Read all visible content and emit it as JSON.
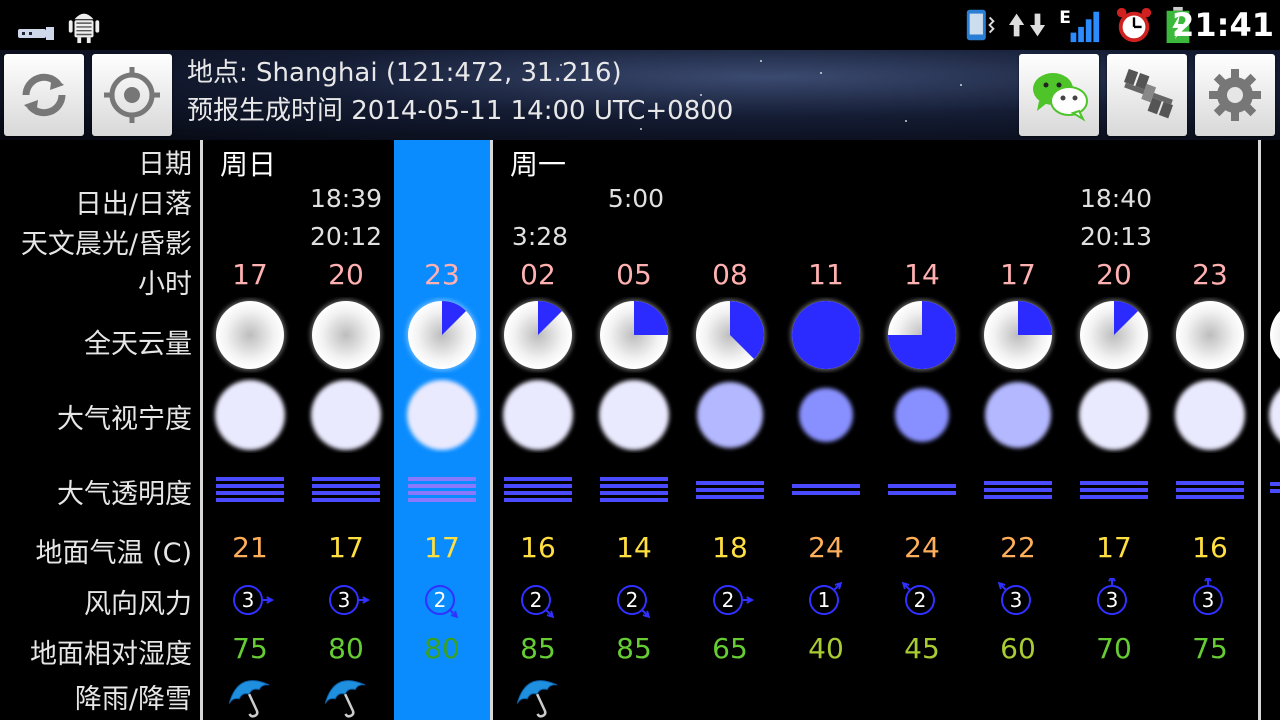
{
  "status_bar": {
    "time": "21:41",
    "icons": [
      "usb-icon",
      "android-debug-icon",
      "vibrate-icon",
      "data-updown-icon",
      "signal-e-icon",
      "alarm-icon",
      "battery-charging-icon"
    ]
  },
  "header": {
    "location_line": "地点: Shanghai (121:472, 31.216)",
    "generated_line": "预报生成时间 2014-05-11 14:00 UTC+0800",
    "buttons": [
      "refresh-button",
      "locate-button",
      "wechat-share-button",
      "satellite-button",
      "settings-button"
    ]
  },
  "row_labels": {
    "date": "日期",
    "sunrise_sunset": "日出/日落",
    "twilight": "天文晨光/昏影",
    "hour": "小时",
    "cloud": "全天云量",
    "seeing": "大气视宁度",
    "transparency": "大气透明度",
    "temperature": "地面气温 (C)",
    "wind": "风向风力",
    "humidity": "地面相对湿度",
    "precipitation": "降雨/降雪"
  },
  "days": [
    {
      "name": "周日"
    },
    {
      "name": "周一"
    }
  ],
  "sun_events": {
    "sunday_sunset": "18:39",
    "sunday_twilight_end": "20:12",
    "monday_sunrise": "5:00",
    "monday_twilight_start": "3:28",
    "monday_sunset": "18:40",
    "monday_twilight_end": "20:13"
  },
  "colors": {
    "selected_column": "#0a8cff",
    "cloud_fill": "#2b2bff",
    "hour_text": "#ffb0b0",
    "temp_orange": "#ffae5a",
    "temp_yellow": "#ffe040",
    "humidity_green": "#66cc33",
    "humidity_lime": "#aacc33"
  },
  "columns": [
    {
      "hour": "17",
      "cloud": 0,
      "seeing": 1,
      "transparency": 3,
      "temp": "21",
      "temp_color": "orange",
      "wind_force": "3",
      "wind_dir": "E",
      "humidity": "75",
      "hum_color": "green",
      "rain": true
    },
    {
      "hour": "20",
      "cloud": 0,
      "seeing": 1,
      "transparency": 3,
      "temp": "17",
      "temp_color": "yellow",
      "wind_force": "3",
      "wind_dir": "E",
      "humidity": "80",
      "hum_color": "green",
      "rain": true
    },
    {
      "hour": "23",
      "cloud": 0.125,
      "seeing": 1,
      "transparency": 3,
      "temp": "17",
      "temp_color": "yellow",
      "wind_force": "2",
      "wind_dir": "SE",
      "humidity": "80",
      "hum_color": "green",
      "rain": false,
      "selected": true
    },
    {
      "hour": "02",
      "cloud": 0.125,
      "seeing": 1,
      "transparency": 3,
      "temp": "16",
      "temp_color": "yellow",
      "wind_force": "2",
      "wind_dir": "SE",
      "humidity": "85",
      "hum_color": "green",
      "rain": true
    },
    {
      "hour": "05",
      "cloud": 0.25,
      "seeing": 1,
      "transparency": 3,
      "temp": "14",
      "temp_color": "yellow",
      "wind_force": "2",
      "wind_dir": "SE",
      "humidity": "85",
      "hum_color": "green",
      "rain": false
    },
    {
      "hour": "08",
      "cloud": 0.375,
      "seeing": 2,
      "transparency": 2,
      "temp": "18",
      "temp_color": "yellow",
      "wind_force": "2",
      "wind_dir": "E",
      "humidity": "65",
      "hum_color": "green",
      "rain": false
    },
    {
      "hour": "11",
      "cloud": 1,
      "seeing": 4,
      "transparency": 1,
      "temp": "24",
      "temp_color": "orange",
      "wind_force": "1",
      "wind_dir": "NE",
      "humidity": "40",
      "hum_color": "lime",
      "rain": false
    },
    {
      "hour": "14",
      "cloud": 0.75,
      "seeing": 4,
      "transparency": 1,
      "temp": "24",
      "temp_color": "orange",
      "wind_force": "2",
      "wind_dir": "NW",
      "humidity": "45",
      "hum_color": "lime",
      "rain": false
    },
    {
      "hour": "17",
      "cloud": 0.25,
      "seeing": 2,
      "transparency": 2,
      "temp": "22",
      "temp_color": "orange",
      "wind_force": "3",
      "wind_dir": "NW",
      "humidity": "60",
      "hum_color": "lime",
      "rain": false
    },
    {
      "hour": "20",
      "cloud": 0.125,
      "seeing": 1,
      "transparency": 2,
      "temp": "17",
      "temp_color": "yellow",
      "wind_force": "3",
      "wind_dir": "N",
      "humidity": "70",
      "hum_color": "green",
      "rain": false
    },
    {
      "hour": "23",
      "cloud": 0,
      "seeing": 1,
      "transparency": 2,
      "temp": "16",
      "temp_color": "yellow",
      "wind_force": "3",
      "wind_dir": "N",
      "humidity": "75",
      "hum_color": "green",
      "rain": false
    }
  ]
}
